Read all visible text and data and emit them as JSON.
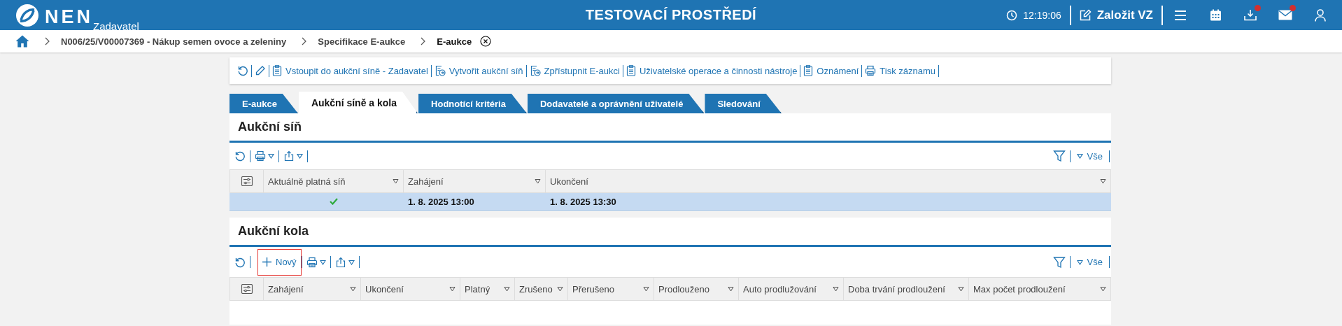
{
  "header": {
    "logo": "NEN",
    "subtitle": "Zadavatel",
    "environment": "TESTOVACÍ PROSTŘEDÍ",
    "time": "12:19:06",
    "create_button": "Založit VZ",
    "icons": [
      {
        "kind": "menu",
        "badge": false
      },
      {
        "kind": "calendar",
        "badge": false
      },
      {
        "kind": "download",
        "badge": true
      },
      {
        "kind": "mail",
        "badge": true
      },
      {
        "kind": "user",
        "badge": false
      }
    ]
  },
  "breadcrumb": [
    {
      "label": "N006/25/V00007369 - Nákup semen ovoce a zeleniny",
      "current": false
    },
    {
      "label": "Specifikace E-aukce",
      "current": false
    },
    {
      "label": "E-aukce",
      "current": true
    }
  ],
  "toolbar": [
    {
      "kind": "refresh"
    },
    {
      "kind": "edit"
    },
    {
      "kind": "doc",
      "label": "Vstoupit do aukční síně - Zadavatel"
    },
    {
      "kind": "doc-arrow",
      "label": "Vytvořit aukční síň"
    },
    {
      "kind": "doc-arrow",
      "label": "Zpřístupnit E-aukci"
    },
    {
      "kind": "doc",
      "label": "Uživatelské operace a činnosti nástroje"
    },
    {
      "kind": "doc",
      "label": "Oznámení"
    },
    {
      "kind": "print",
      "label": "Tisk záznamu"
    }
  ],
  "tabs": [
    {
      "label": "E-aukce",
      "selected": false
    },
    {
      "label": "Aukční síně a kola",
      "selected": true
    },
    {
      "label": "Hodnotící kritéria",
      "selected": false
    },
    {
      "label": "Dodavatelé a oprávnění uživatelé",
      "selected": false
    },
    {
      "label": "Sledování",
      "selected": false
    }
  ],
  "sections": [
    {
      "title": "Aukční síň",
      "filter_label": "Vše",
      "columns": [
        "Aktuálně platná síň",
        "Zahájení",
        "Ukončení"
      ],
      "rows": [
        {
          "selected": true,
          "current": true,
          "cells": [
            "",
            "1. 8. 2025 13:00",
            "1. 8. 2025 13:30"
          ]
        }
      ]
    },
    {
      "title": "Aukční kola",
      "new_button": {
        "label": "Nový",
        "highlighted": true
      },
      "filter_label": "Vše",
      "columns": [
        "Zahájení",
        "Ukončení",
        "Platný",
        "Zrušeno",
        "Přerušeno",
        "Prodlouženo",
        "Auto prodlužování",
        "Doba trvání prodloužení",
        "Max počet prodloužení"
      ]
    }
  ]
}
